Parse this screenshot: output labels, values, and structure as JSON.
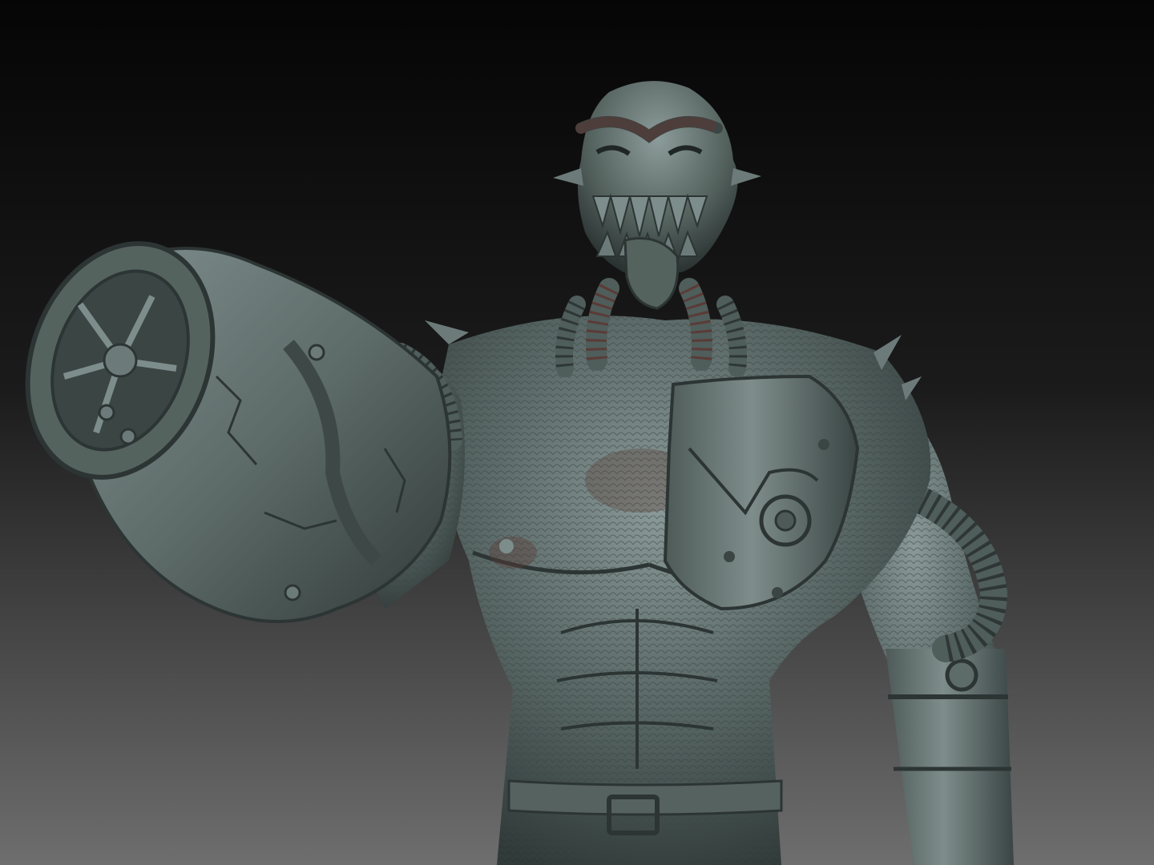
{
  "scene": {
    "colors": {
      "background_top": "#050505",
      "background_bottom": "#6e6e6e",
      "clay_light": "#7d8d8b",
      "clay_mid": "#566563",
      "clay_dark": "#2c3534",
      "rust_shadow": "#5a3b36",
      "metal": "#6c7b7a"
    },
    "subject": {
      "icon": "sculpt-creature-icon"
    }
  }
}
